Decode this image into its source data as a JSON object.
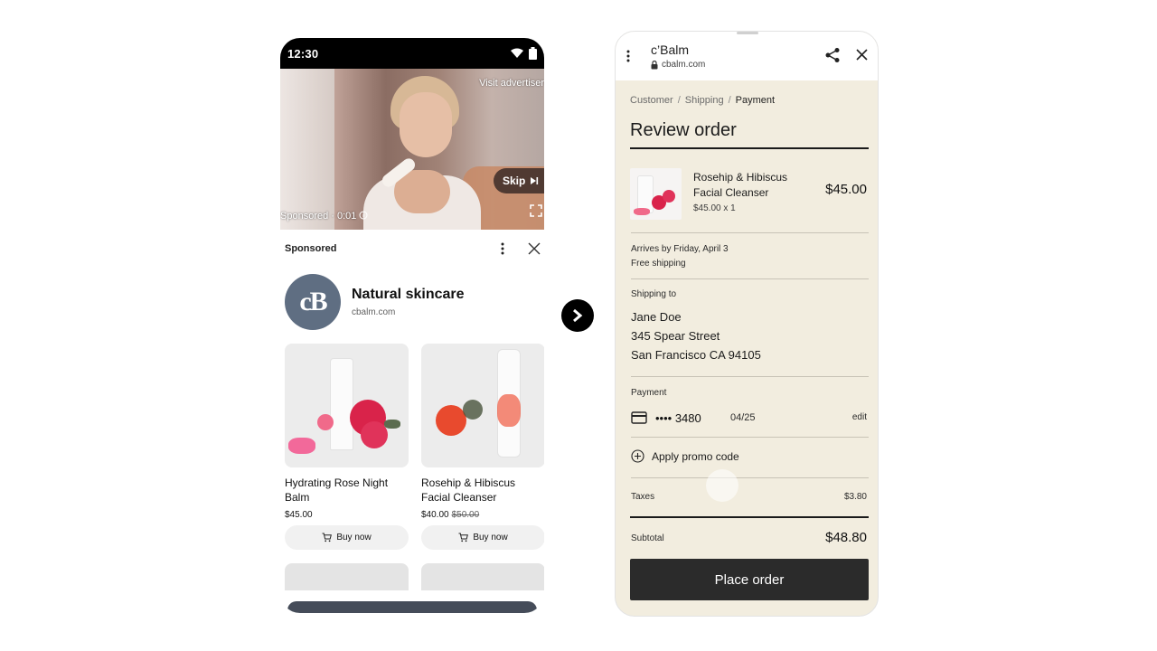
{
  "left_phone": {
    "status_time": "12:30",
    "video": {
      "visit_advertiser": "Visit advertiser",
      "skip_label": "Skip",
      "sponsored_time": "Sponsored · 0:01",
      "progress_fraction": 0.35
    },
    "ad_header": {
      "label": "Sponsored"
    },
    "advertiser": {
      "logo_text": "cB",
      "title": "Natural skincare",
      "domain": "cbalm.com"
    },
    "products": [
      {
        "name": "Hydrating Rose Night Balm",
        "price": "$45.00",
        "old_price": "",
        "button": "Buy now"
      },
      {
        "name": "Rosehip & Hibiscus Facial Cleanser",
        "price": "$40.00",
        "old_price": "$50.00",
        "button": "Buy now"
      }
    ]
  },
  "right_phone": {
    "browser": {
      "title": "c’Balm",
      "url": "cbalm.com"
    },
    "breadcrumb": [
      "Customer",
      "Shipping",
      "Payment"
    ],
    "heading": "Review order",
    "item": {
      "name": "Rosehip & Hibiscus Facial Cleanser",
      "meta": "$45.00  x 1",
      "price": "$45.00"
    },
    "delivery": {
      "arrives": "Arrives by Friday, April 3",
      "shipping": "Free shipping"
    },
    "shipping": {
      "label": "Shipping to",
      "name": "Jane Doe",
      "street": "345 Spear Street",
      "city": "San Francisco CA 94105"
    },
    "payment": {
      "label": "Payment",
      "card": "•••• 3480",
      "expiry": "04/25",
      "edit": "edit"
    },
    "promo": "Apply promo code",
    "taxes": {
      "label": "Taxes",
      "value": "$3.80"
    },
    "subtotal": {
      "label": "Subtotal",
      "value": "$48.80"
    },
    "place_order": "Place order"
  },
  "colors": {
    "accent_progress": "#f4c000",
    "logo_bg": "#5f6e82",
    "checkout_bg": "#f2eddf",
    "button_dark": "#2b2b2b"
  },
  "icons": [
    "wifi-icon",
    "battery-icon",
    "skip-next-icon",
    "info-icon",
    "fullscreen-icon",
    "more-vert-icon",
    "close-icon",
    "cart-icon",
    "chevron-right-icon",
    "lock-icon",
    "share-icon",
    "credit-card-icon",
    "add-circle-icon"
  ]
}
